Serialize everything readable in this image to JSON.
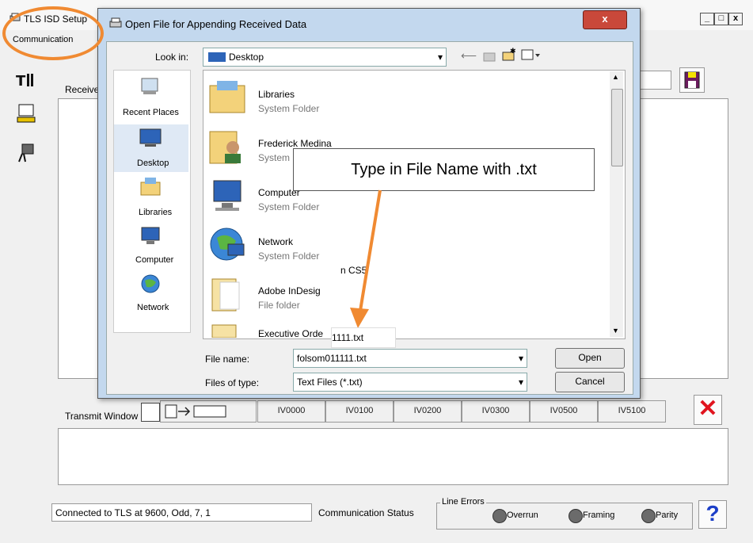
{
  "main": {
    "title": "TLS ISD Setup",
    "tabs": [
      "Communication"
    ],
    "receive_label": "Receive",
    "transmit_label": "Transmit Window",
    "transmit_buttons": [
      "IV0000",
      "IV0100",
      "IV0200",
      "IV0300",
      "IV0500",
      "IV5100"
    ],
    "status_text": "Connected to TLS at 9600, Odd, 7, 1",
    "communication_status_label": "Communication Status",
    "line_errors": {
      "label": "Line Errors",
      "items": [
        "Overrun",
        "Framing",
        "Parity"
      ]
    },
    "window_controls": [
      "_",
      "□",
      "x"
    ]
  },
  "dialog": {
    "title": "Open File for Appending Received Data",
    "look_in_label": "Look in:",
    "look_in_value": "Desktop",
    "places": [
      "Recent Places",
      "Desktop",
      "Libraries",
      "Computer",
      "Network"
    ],
    "files": [
      {
        "name": "Libraries",
        "type": "System Folder"
      },
      {
        "name": "Frederick Medina",
        "type": "System Folder"
      },
      {
        "name": "Computer",
        "type": "System Folder"
      },
      {
        "name": "Network",
        "type": "System Folder"
      },
      {
        "name": "Adobe InDesig",
        "type": "File folder"
      },
      {
        "name": "Executive Orde",
        "type": ""
      }
    ],
    "partial_label_cs5": "n CS5",
    "file_name_label": "File name:",
    "file_name_value": "folsom011111.txt",
    "files_of_type_label": "Files of type:",
    "files_of_type_value": "Text Files (*.txt)",
    "open_button": "Open",
    "cancel_button": "Cancel"
  },
  "annotations": {
    "callout_text": "Type in File Name with .txt",
    "typed_text": "1111.txt",
    "accent_color": "#f08a32"
  },
  "colors": {
    "close_x": "#e0141e",
    "help": "#1c3fc8",
    "dialog_close": "#c9483a"
  }
}
